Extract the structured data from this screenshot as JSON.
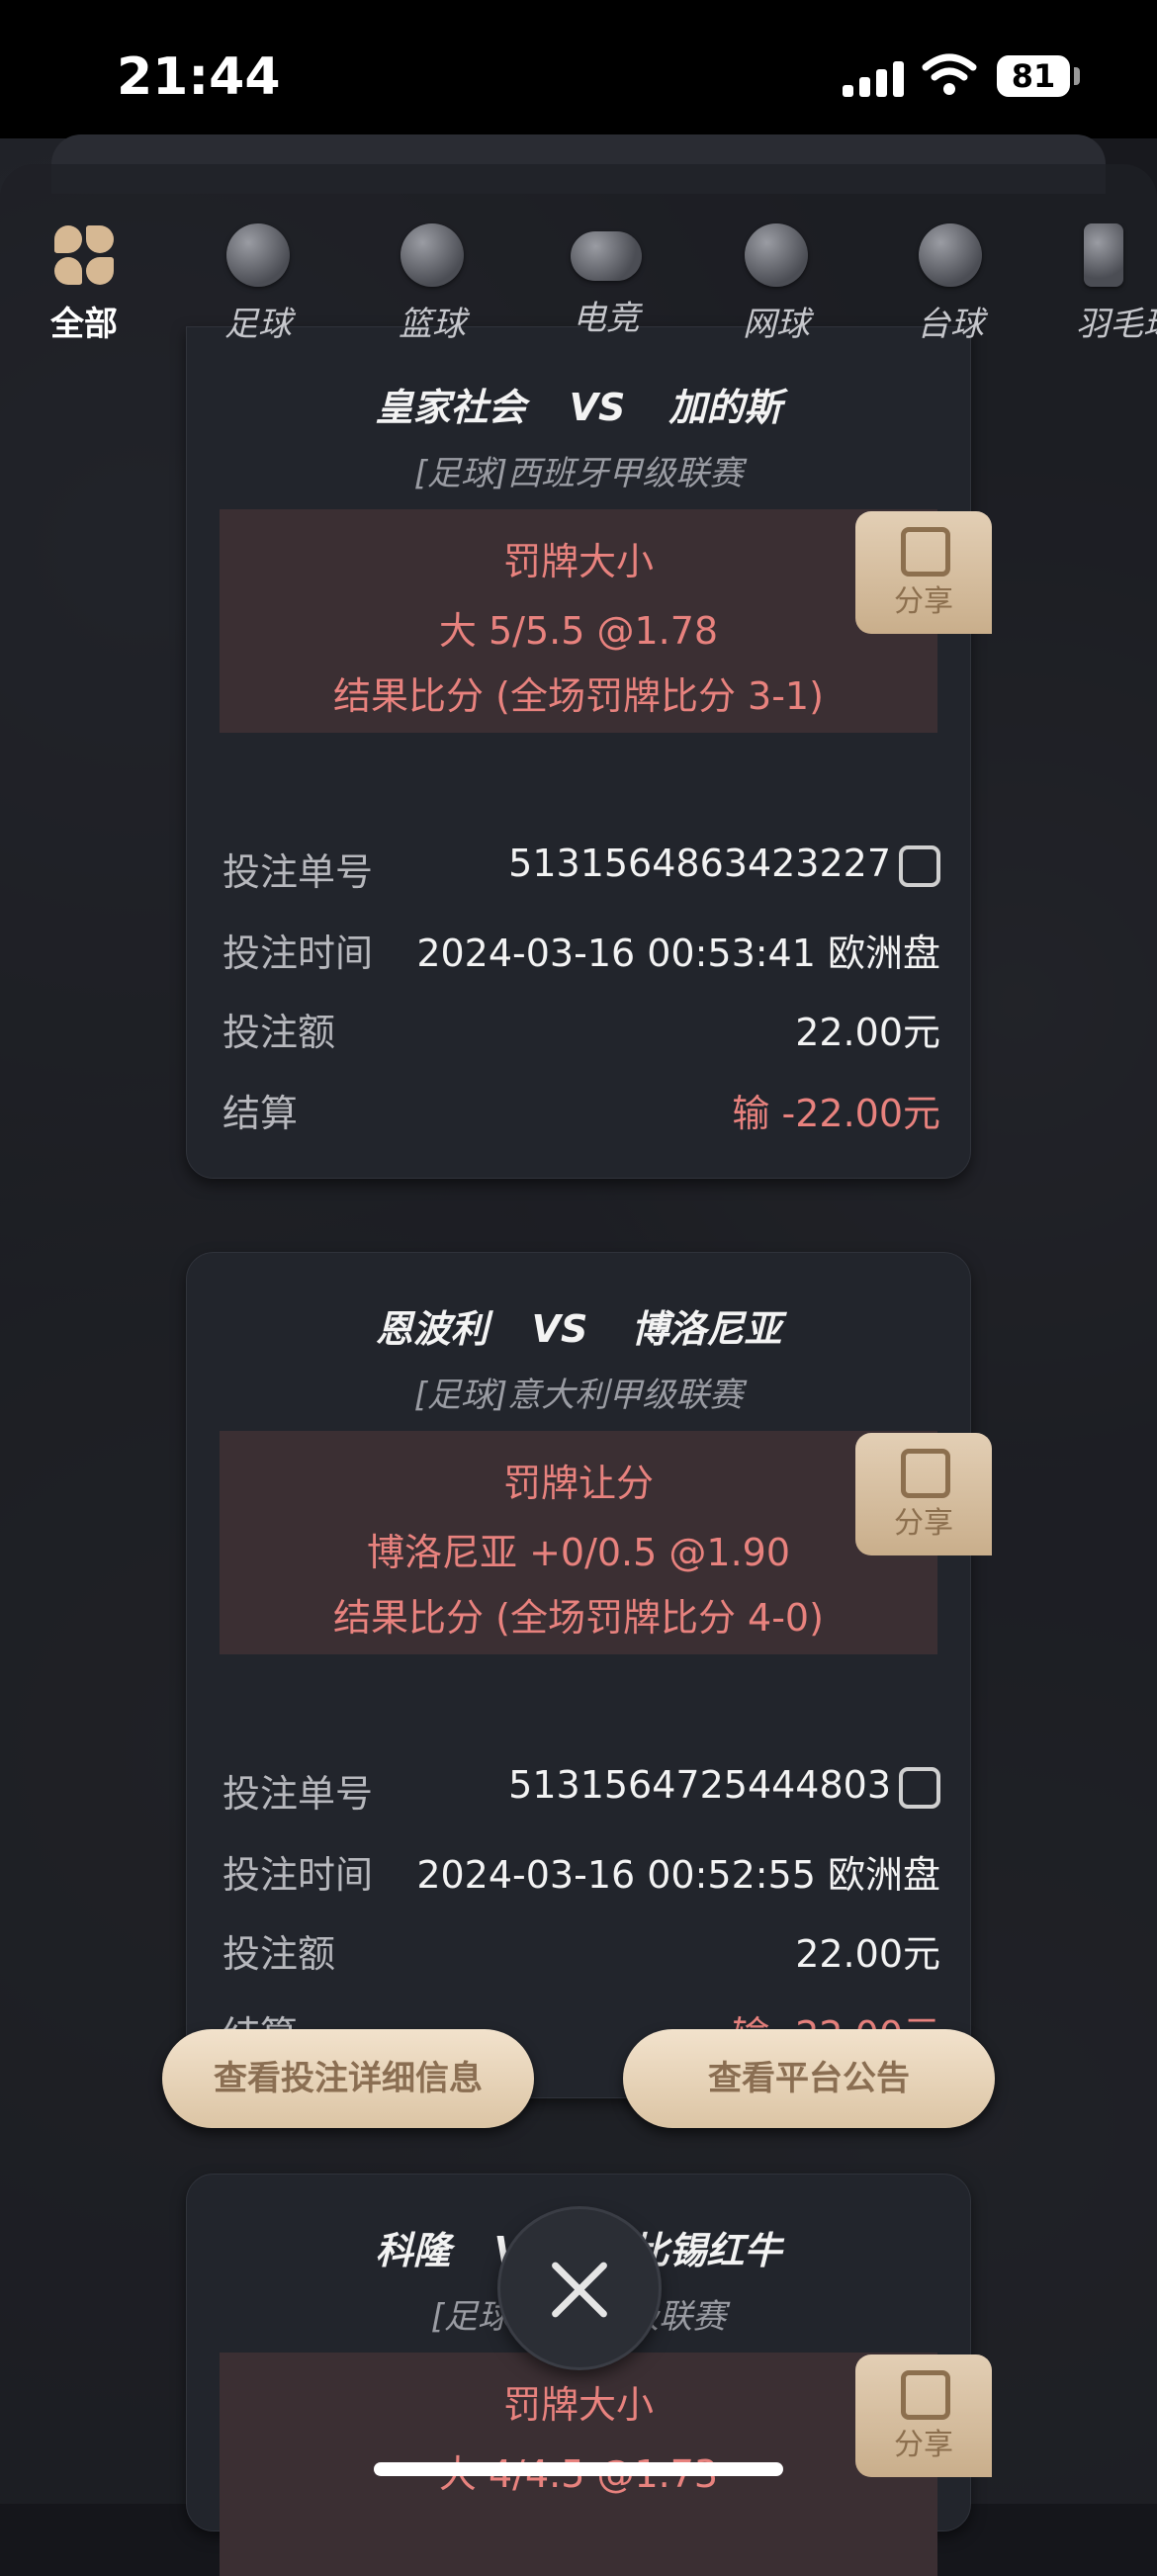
{
  "status": {
    "time": "21:44",
    "battery": "81"
  },
  "tabs": [
    {
      "label": "全部"
    },
    {
      "label": "足球"
    },
    {
      "label": "篮球"
    },
    {
      "label": "电竞"
    },
    {
      "label": "网球"
    },
    {
      "label": "台球"
    },
    {
      "label": "羽毛球"
    }
  ],
  "cards": [
    {
      "home": "皇家社会",
      "vs": "VS",
      "away": "加的斯",
      "league": "[足球]西班牙甲级联赛",
      "market": "罚牌大小",
      "selection": "大 5/5.5 @1.78",
      "result": "结果比分 (全场罚牌比分 3-1)",
      "share": "分享",
      "bet_no_label": "投注单号",
      "bet_no": "5131564863423227",
      "time_label": "投注时间",
      "time": "2024-03-16 00:53:41 欧洲盘",
      "amount_label": "投注额",
      "amount": "22.00元",
      "settle_label": "结算",
      "settle": "输 -22.00元"
    },
    {
      "home": "恩波利",
      "vs": "VS",
      "away": "博洛尼亚",
      "league": "[足球]意大利甲级联赛",
      "market": "罚牌让分",
      "selection": "博洛尼亚  +0/0.5 @1.90",
      "result": "结果比分 (全场罚牌比分 4-0)",
      "share": "分享",
      "bet_no_label": "投注单号",
      "bet_no": "5131564725444803",
      "time_label": "投注时间",
      "time": "2024-03-16 00:52:55 欧洲盘",
      "amount_label": "投注额",
      "amount": "22.00元",
      "settle_label": "结算",
      "settle": "输 -22.00元"
    },
    {
      "home": "科隆",
      "vs": "VS",
      "away": "莱比锡红牛",
      "league": "[足球]德国甲级联赛",
      "market": "罚牌大小",
      "selection": "大 4/4.5 @1.73",
      "share": "分享"
    }
  ],
  "buttons": {
    "details": "查看投注详细信息",
    "notice": "查看平台公告"
  },
  "icons": {
    "close": "close-icon",
    "share": "share-icon",
    "copy": "copy-icon"
  }
}
